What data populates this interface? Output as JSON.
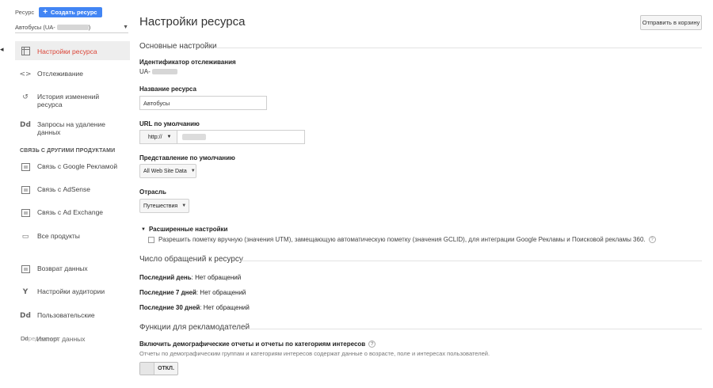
{
  "sidebar": {
    "resource_label": "Ресурс",
    "create_button": "Создать ресурс",
    "account_select": "Автобусы (UA-",
    "section_connections": "СВЯЗЬ С ДРУГИМИ ПРОДУКТАМИ",
    "items": [
      {
        "label": "Настройки ресурса",
        "icon": "table-icon"
      },
      {
        "label": "Отслеживание",
        "icon": "code-icon"
      },
      {
        "label": "История изменений ресурса",
        "icon": "history-icon"
      },
      {
        "label": "Запросы на удаление данных",
        "icon": "dd-icon"
      },
      {
        "label": "Связь с Google Рекламой",
        "icon": "ads-icon"
      },
      {
        "label": "Связь с AdSense",
        "icon": "adsense-icon"
      },
      {
        "label": "Связь с Ad Exchange",
        "icon": "adexchange-icon"
      },
      {
        "label": "Все продукты",
        "icon": "products-icon"
      },
      {
        "label": "Возврат данных",
        "icon": "data-return-icon"
      },
      {
        "label": "Настройки аудитории",
        "icon": "audience-icon"
      },
      {
        "label": "Пользовательские",
        "icon": "dd-icon"
      }
    ],
    "overlap_a": "Dd",
    "overlap_b": "Импорт данных",
    "overlap_c": "Определения"
  },
  "main": {
    "title": "Настройки ресурса",
    "trash_button": "Отправить в корзину",
    "basic_section": "Основные настройки",
    "tracking_id_label": "Идентификатор отслеживания",
    "tracking_id_value": "UA-",
    "name_label": "Название ресурса",
    "name_value": "Автобусы",
    "url_label": "URL по умолчанию",
    "url_protocol": "http://",
    "view_label": "Представление по умолчанию",
    "view_value": "All Web Site Data",
    "industry_label": "Отрасль",
    "industry_value": "Путешествия",
    "advanced_title": "Расширенные настройки",
    "advanced_option": "Разрешить пометку вручную (значения UTM), замещающую автоматическую пометку (значения GCLID), для интеграции Google Рекламы и Поисковой рекламы 360.",
    "hits_section": "Число обращений к ресурсу",
    "stats": [
      {
        "period": "Последний день",
        "value": ": Нет обращений"
      },
      {
        "period": "Последние 7 дней",
        "value": ": Нет обращений"
      },
      {
        "period": "Последние 30 дней",
        "value": ": Нет обращений"
      }
    ],
    "advertisers_section": "Функции для рекламодателей",
    "demo_title": "Включить демографические отчеты и отчеты по категориям интересов",
    "demo_desc": "Отчеты по демографическим группам и категориям интересов содержат данные о возрасте, поле и интересах пользователей.",
    "toggle_state": "ОТКЛ."
  },
  "colors": {
    "accent": "#4285f4",
    "active_nav": "#db4437"
  }
}
